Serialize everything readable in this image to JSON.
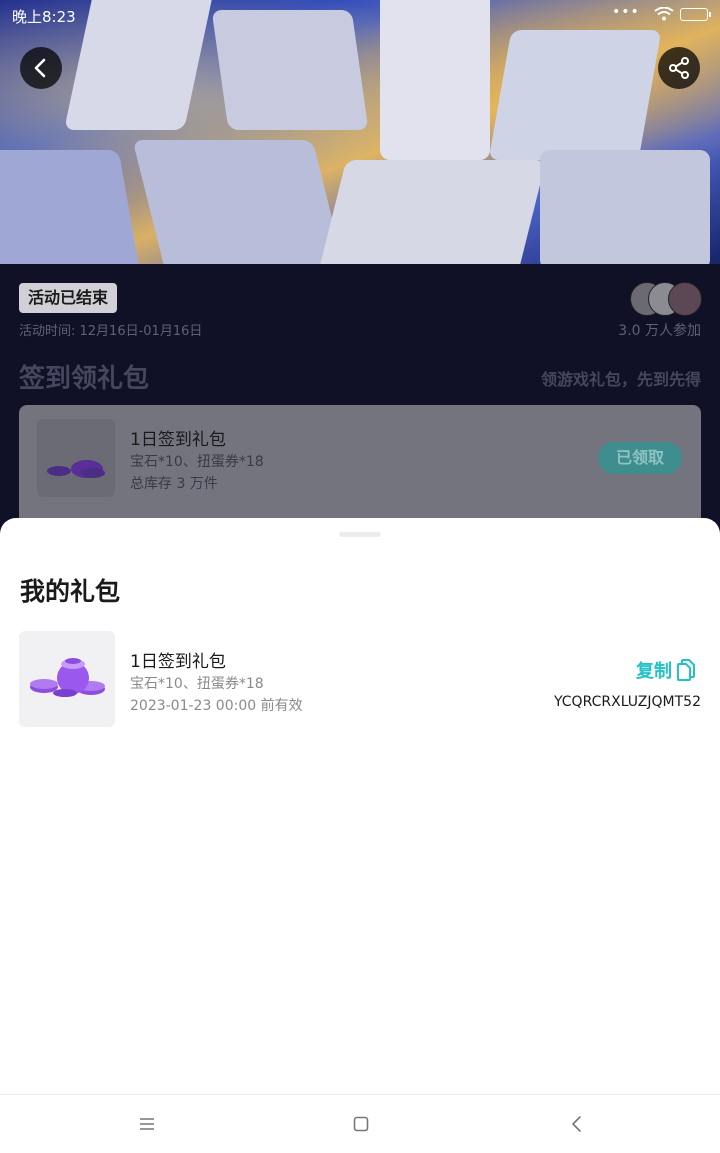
{
  "status_bar": {
    "time": "晚上8:23",
    "dots": "•••"
  },
  "hero": {
    "back_icon": "chevron-left-icon",
    "share_icon": "share-icon"
  },
  "activity": {
    "status": "活动已结束",
    "time": "活动时间: 12月16日-01月16日",
    "participants": "3.0 万人参加",
    "section_title": "签到领礼包",
    "section_slogan": "领游戏礼包，先到先得",
    "gift": {
      "name": "1日签到礼包",
      "desc": "宝石*10、扭蛋券*18",
      "stock": "总库存 3 万件",
      "button": "已领取"
    }
  },
  "my_gifts": {
    "title": "我的礼包",
    "item": {
      "name": "1日签到礼包",
      "desc": "宝石*10、扭蛋券*18",
      "expiry": "2023-01-23 00:00 前有效",
      "copy_label": "复制",
      "code": "YCQRCRXLUZJQMT52"
    }
  },
  "nav": {
    "menu_icon": "menu-icon",
    "home_icon": "square-home-icon",
    "back_icon": "triangle-back-icon"
  },
  "colors": {
    "accent": "#23c2c5",
    "dim_bg": "#101026"
  }
}
